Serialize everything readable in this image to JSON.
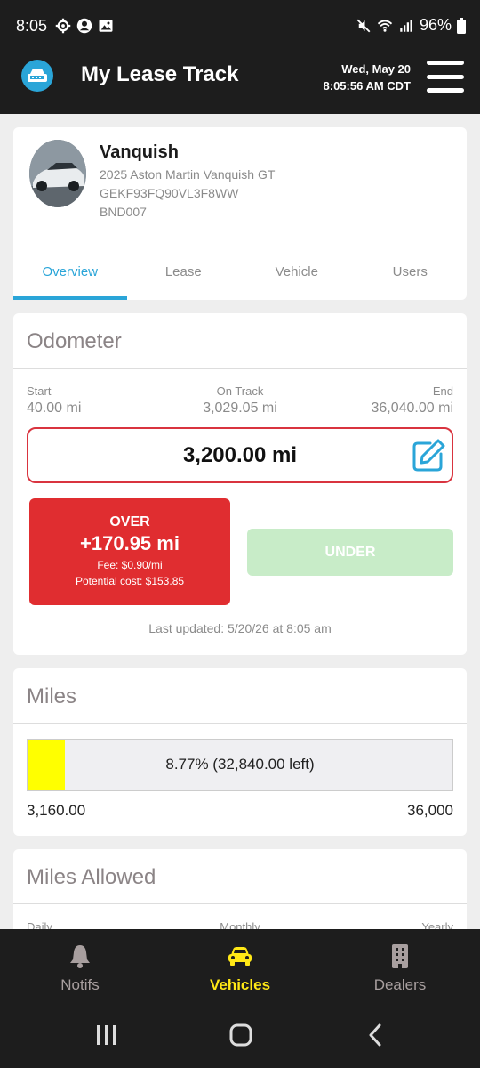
{
  "status_bar": {
    "time": "8:05",
    "icons": [
      "gear-icon",
      "account-icon",
      "image-icon"
    ],
    "right_icons": [
      "mute-icon",
      "wifi-icon",
      "signal-icon",
      "battery-icon"
    ],
    "battery": "96%"
  },
  "app": {
    "title": "My Lease Track",
    "date": "Wed, May 20",
    "time": "8:05:56 AM CDT",
    "accent_color": "#2aa5d8"
  },
  "vehicle": {
    "name": "Vanquish",
    "model": "2025 Aston Martin Vanquish GT",
    "vin": "GEKF93FQ90VL3F8WW",
    "plate": "BND007"
  },
  "tabs": [
    {
      "label": "Overview",
      "active": true
    },
    {
      "label": "Lease",
      "active": false
    },
    {
      "label": "Vehicle",
      "active": false
    },
    {
      "label": "Users",
      "active": false
    }
  ],
  "odometer": {
    "title": "Odometer",
    "start_label": "Start",
    "start_value": "40.00 mi",
    "ontrack_label": "On Track",
    "ontrack_value": "3,029.05 mi",
    "end_label": "End",
    "end_value": "36,040.00 mi",
    "current": "3,200.00 mi",
    "over": {
      "title": "OVER",
      "amount": "+170.95 mi",
      "fee": "Fee: $0.90/mi",
      "cost": "Potential cost: $153.85",
      "color": "#e02d30"
    },
    "under_label": "UNDER",
    "last_updated": "Last updated: 5/20/26 at 8:05 am"
  },
  "miles": {
    "title": "Miles",
    "progress_percent": 8.77,
    "progress_text": "8.77% (32,840.00 left)",
    "used": "3,160.00",
    "total": "36,000"
  },
  "miles_allowed": {
    "title": "Miles Allowed",
    "labels": [
      "Daily",
      "Monthly",
      "Yearly"
    ]
  },
  "bottom_nav": [
    {
      "label": "Notifs",
      "icon": "bell-icon",
      "active": false
    },
    {
      "label": "Vehicles",
      "icon": "car-icon",
      "active": true
    },
    {
      "label": "Dealers",
      "icon": "building-icon",
      "active": false
    }
  ]
}
